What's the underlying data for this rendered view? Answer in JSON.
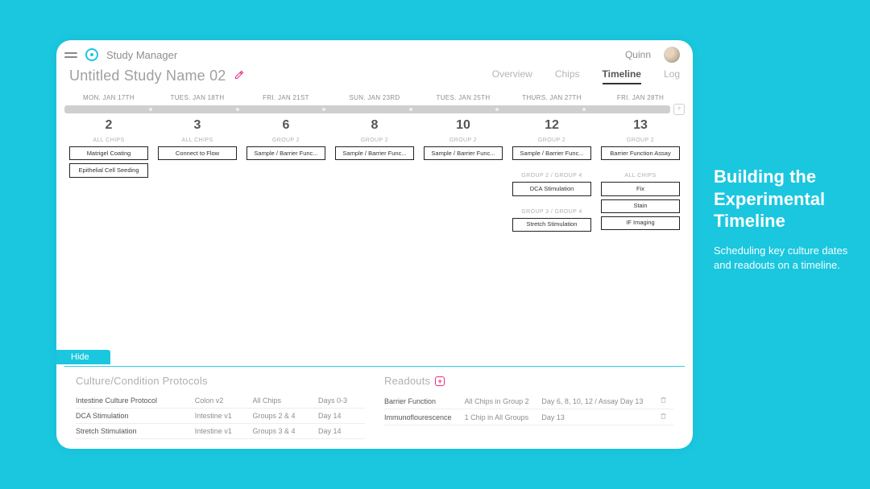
{
  "colors": {
    "accent": "#1ac7df",
    "pink": "#ec2c85"
  },
  "header": {
    "app_title": "Study Manager",
    "user": "Quinn"
  },
  "subheader": {
    "study_name": "Untitled Study Name 02",
    "tabs": {
      "overview": "Overview",
      "chips": "Chips",
      "timeline": "Timeline",
      "log": "Log"
    },
    "active_tab": "timeline"
  },
  "timeline": {
    "columns": [
      {
        "date": "MON. JAN 17TH",
        "day": "2",
        "groups": [
          {
            "label": "ALL CHIPS",
            "items": [
              "Matrigel Coating",
              "Epithelial Cell Seeding"
            ]
          }
        ]
      },
      {
        "date": "TUES. JAN 18TH",
        "day": "3",
        "groups": [
          {
            "label": "ALL CHIPS",
            "items": [
              "Connect to Flow"
            ]
          }
        ]
      },
      {
        "date": "FRI. JAN 21ST",
        "day": "6",
        "groups": [
          {
            "label": "GROUP 2",
            "items": [
              "Sample / Barrier Func..."
            ]
          }
        ]
      },
      {
        "date": "SUN. JAN 23RD",
        "day": "8",
        "groups": [
          {
            "label": "GROUP 2",
            "items": [
              "Sample / Barrier Func..."
            ]
          }
        ]
      },
      {
        "date": "TUES. JAN 25TH",
        "day": "10",
        "groups": [
          {
            "label": "GROUP 2",
            "items": [
              "Sample / Barrier Func..."
            ]
          }
        ]
      },
      {
        "date": "THURS. JAN 27TH",
        "day": "12",
        "groups": [
          {
            "label": "GROUP 2",
            "items": [
              "Sample / Barrier Func..."
            ]
          },
          {
            "label": "GROUP 2 / GROUP 4",
            "items": [
              "DCA Stimulation"
            ]
          },
          {
            "label": "GROUP 3 / GROUP 4",
            "items": [
              "Stretch Stimulation"
            ]
          }
        ]
      },
      {
        "date": "FRI. JAN 28TH",
        "day": "13",
        "groups": [
          {
            "label": "GROUP 2",
            "items": [
              "Barrier Function Assay"
            ]
          },
          {
            "label": "ALL CHIPS",
            "items": [
              "Fix",
              "Stain",
              "IF Imaging"
            ]
          }
        ]
      }
    ],
    "add_label": "+"
  },
  "panels": {
    "hide_label": "Hide",
    "protocols": {
      "title": "Culture/Condition Protocols",
      "rows": [
        {
          "name": "Intestine Culture Protocol",
          "variant": "Colon v2",
          "scope": "All Chips",
          "when": "Days 0-3"
        },
        {
          "name": "DCA Stimulation",
          "variant": "Intestine v1",
          "scope": "Groups 2 & 4",
          "when": "Day 14"
        },
        {
          "name": "Stretch Stimulation",
          "variant": "Intestine v1",
          "scope": "Groups 3 & 4",
          "when": "Day 14"
        }
      ]
    },
    "readouts": {
      "title": "Readouts",
      "add_label": "+",
      "rows": [
        {
          "name": "Barrier Function",
          "scope": "All Chips in Group 2",
          "when": "Day 6, 8, 10, 12 / Assay Day 13"
        },
        {
          "name": "Immunoflourescence",
          "scope": "1 Chip in All Groups",
          "when": "Day 13"
        }
      ]
    }
  },
  "side": {
    "title": "Building the Experimental Timeline",
    "body": "Scheduling key culture dates and readouts on a timeline."
  }
}
